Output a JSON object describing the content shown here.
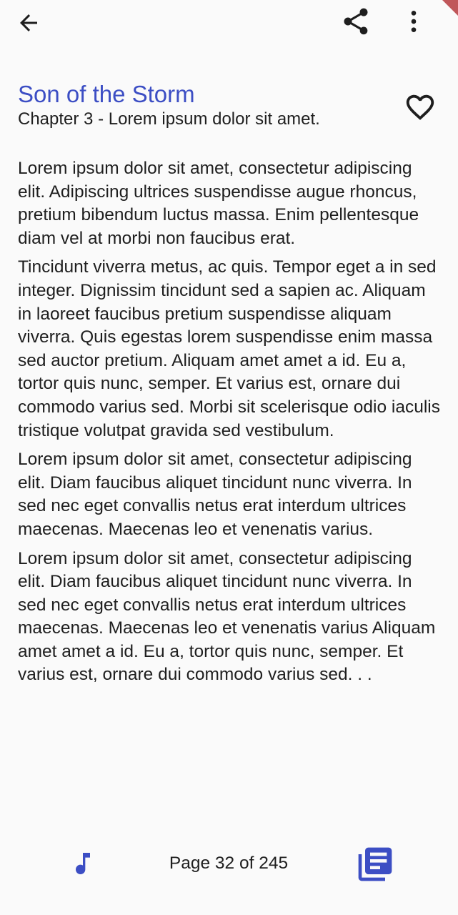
{
  "app_bar": {
    "icons": {
      "back": "arrow-back-icon",
      "share": "share-icon",
      "more": "more-vertical-icon"
    }
  },
  "book": {
    "title": "Son of the Storm",
    "chapter": "Chapter 3 - Lorem ipsum dolor sit amet.",
    "favorite_icon": "heart-outline-icon"
  },
  "content": {
    "paragraphs": [
      "Lorem ipsum dolor sit amet, consectetur adipiscing elit. Adipiscing ultrices suspendisse augue rhoncus, pretium bibendum luctus massa. Enim pellentesque diam vel at morbi non faucibus erat.",
      "Tincidunt viverra metus, ac quis. Tempor eget a in sed integer. Dignissim tincidunt sed a sapien ac. Aliquam in laoreet faucibus pretium suspendisse aliquam viverra. Quis egestas lorem suspendisse enim massa sed auctor pretium. Aliquam amet amet a id. Eu a, tortor quis nunc, semper. Et varius est, ornare dui commodo varius sed. Morbi sit scelerisque odio iaculis tristique volutpat gravida sed vestibulum.",
      "Lorem ipsum dolor sit amet, consectetur adipiscing elit. Diam faucibus aliquet tincidunt nunc viverra. In sed nec eget convallis netus erat interdum ultrices maecenas. Maecenas leo et venenatis varius.",
      "Lorem ipsum dolor sit amet, consectetur adipiscing elit. Diam faucibus aliquet tincidunt nunc viverra. In sed nec eget convallis netus erat interdum ultrices maecenas. Maecenas leo et venenatis varius Aliquam amet amet a id. Eu a, tortor quis nunc, semper. Et varius est, ornare dui commodo varius sed. . ."
    ]
  },
  "bottom_bar": {
    "page_label": "Page 32 of 245",
    "icons": {
      "music": "music-note-icon",
      "toc": "chapters-list-icon"
    }
  },
  "colors": {
    "accent": "#3c4ec4",
    "text": "#1e1e1e",
    "background": "#fafafa"
  }
}
